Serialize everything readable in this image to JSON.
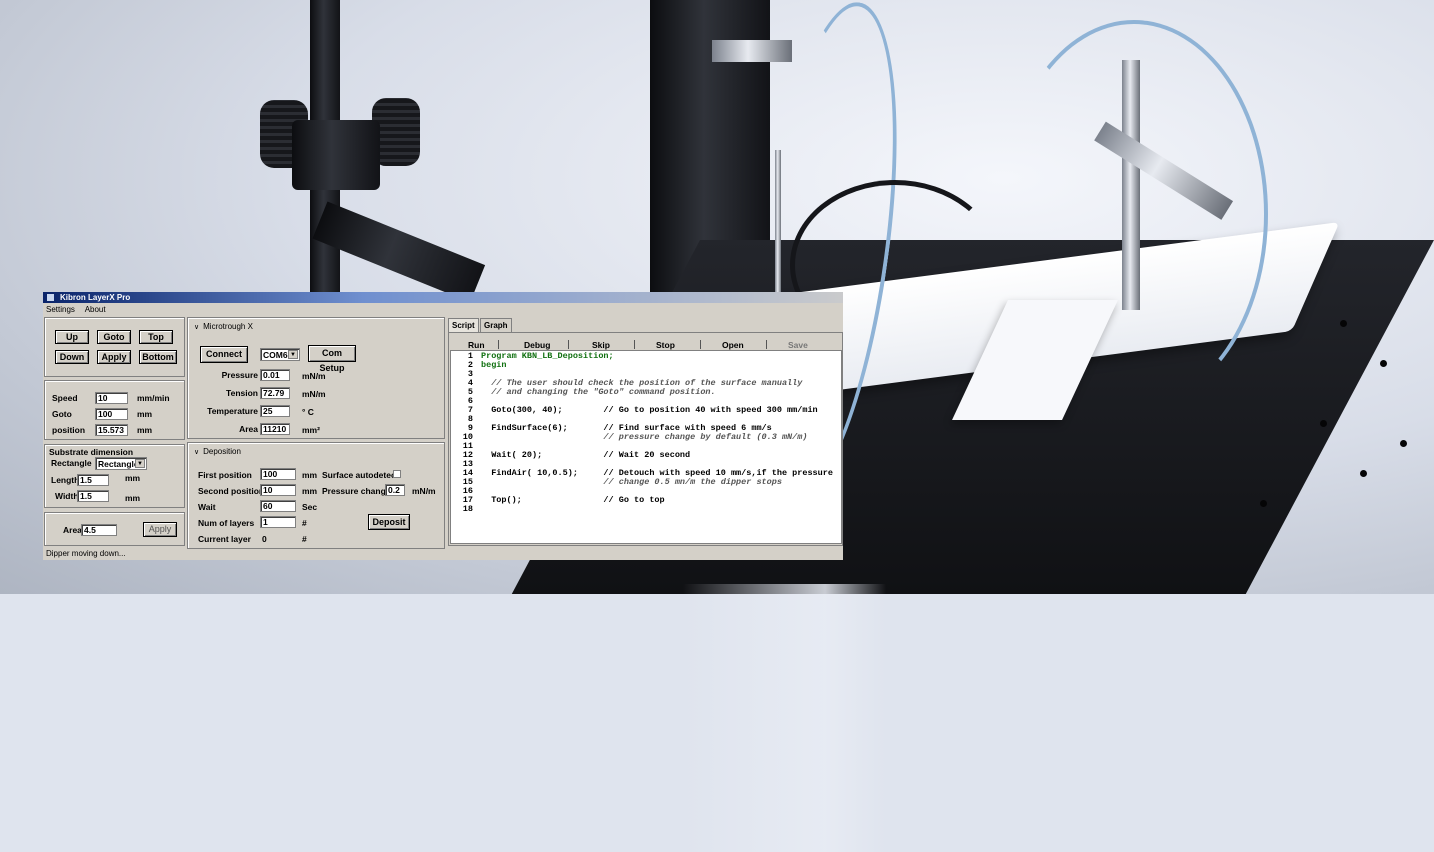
{
  "window": {
    "title": "Kibron LayerX Pro",
    "menu": [
      "Settings",
      "About"
    ],
    "status": "Dipper moving down..."
  },
  "left_panel": {
    "buttons": {
      "up": "Up",
      "goto": "Goto",
      "top": "Top",
      "down": "Down",
      "apply": "Apply",
      "bottom": "Bottom"
    },
    "speed": {
      "label": "Speed",
      "value": "10",
      "unit": "mm/min"
    },
    "goto": {
      "label": "Goto",
      "value": "100",
      "unit": "mm"
    },
    "position": {
      "label": "position",
      "value": "15.573",
      "unit": "mm"
    },
    "substrate": {
      "title": "Substrate dimension",
      "shape_label": "Rectangle",
      "shape_value": "Rectangle",
      "length": {
        "label": "Length",
        "value": "1.5",
        "unit": "mm"
      },
      "width": {
        "label": "Width",
        "value": "1.5",
        "unit": "mm"
      }
    },
    "area": {
      "label": "Area",
      "value": "4.5",
      "apply": "Apply"
    }
  },
  "microtrough": {
    "title": "Microtrough X",
    "connect": "Connect",
    "port": "COM6",
    "com_setup": "Com Setup",
    "pressure": {
      "label": "Pressure",
      "value": "0.01",
      "unit": "mN/m"
    },
    "tension": {
      "label": "Tension",
      "value": "72.79",
      "unit": "mN/m"
    },
    "temperature": {
      "label": "Temperature",
      "value": "25",
      "unit": "° C"
    },
    "area": {
      "label": "Area",
      "value": "11210",
      "unit": "mm²"
    }
  },
  "deposition": {
    "title": "Deposition",
    "first_position": {
      "label": "First position",
      "value": "100",
      "unit": "mm"
    },
    "second_position": {
      "label": "Second position",
      "value": "10",
      "unit": "mm"
    },
    "wait": {
      "label": "Wait",
      "value": "60",
      "unit": "Sec"
    },
    "num_layers": {
      "label": "Num of layers",
      "value": "1",
      "unit": "#"
    },
    "current_layer": {
      "label": "Current layer",
      "value": "0",
      "unit": "#"
    },
    "surface_autodetect": "Surface autodetect",
    "pressure_change": {
      "label": "Pressure change",
      "value": "0.2",
      "unit": "mN/m"
    },
    "deposit": "Deposit"
  },
  "script": {
    "tabs": [
      "Script",
      "Graph"
    ],
    "toolbar": [
      "Run",
      "Debug",
      "Skip",
      "Stop",
      "Open",
      "Save"
    ],
    "lines": [
      {
        "n": "1",
        "code": "Program KBN_LB_Deposition;"
      },
      {
        "n": "2",
        "code": "begin"
      },
      {
        "n": "3",
        "code": ""
      },
      {
        "n": "4",
        "code": "  // The user should check the position of the surface manually"
      },
      {
        "n": "5",
        "code": "  // and changing the \"Goto\" command position."
      },
      {
        "n": "6",
        "code": ""
      },
      {
        "n": "7",
        "code": "  Goto(300, 40);        // Go to position 40 with speed 300 mm/min"
      },
      {
        "n": "8",
        "code": ""
      },
      {
        "n": "9",
        "code": "  FindSurface(6);       // Find surface with speed 6 mm/s"
      },
      {
        "n": "10",
        "code": "                        // pressure change by default (0.3 mN/m)"
      },
      {
        "n": "11",
        "code": ""
      },
      {
        "n": "12",
        "code": "  Wait( 20);            // Wait 20 second"
      },
      {
        "n": "13",
        "code": ""
      },
      {
        "n": "14",
        "code": "  FindAir( 10,0.5);     // Detouch with speed 10 mm/s,if the pressure"
      },
      {
        "n": "15",
        "code": "                        // change 0.5 mn/m the dipper stops"
      },
      {
        "n": "16",
        "code": ""
      },
      {
        "n": "17",
        "code": "  Top();                // Go to top"
      },
      {
        "n": "18",
        "code": ""
      }
    ]
  },
  "colors": {
    "window_bg": "#d4d0c8",
    "title_bar": "#0a246a",
    "keyword": "#107010",
    "number": "#c02020"
  }
}
